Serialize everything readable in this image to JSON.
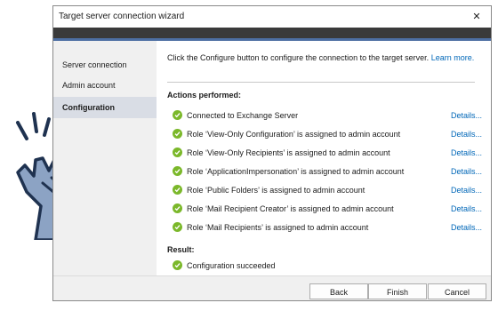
{
  "window": {
    "title": "Target server connection wizard",
    "close_glyph": "✕"
  },
  "sidebar": {
    "items": [
      {
        "label": "Server connection",
        "active": false
      },
      {
        "label": "Admin account",
        "active": false
      },
      {
        "label": "Configuration",
        "active": true
      }
    ]
  },
  "content": {
    "intro_text": "Click the Configure button to configure the connection to the target server.",
    "learn_more": "Learn more.",
    "actions_heading": "Actions performed:",
    "actions": [
      {
        "text": "Connected to Exchange Server",
        "details": "Details..."
      },
      {
        "text": "Role ‘View-Only Configuration’ is assigned to admin account",
        "details": "Details..."
      },
      {
        "text": "Role ‘View-Only Recipients’ is assigned to admin account",
        "details": "Details..."
      },
      {
        "text": "Role ‘ApplicationImpersonation’ is assigned to admin account",
        "details": "Details..."
      },
      {
        "text": "Role ‘Public Folders’ is assigned to admin account",
        "details": "Details..."
      },
      {
        "text": "Role ‘Mail Recipient Creator’ is assigned to admin account",
        "details": "Details..."
      },
      {
        "text": "Role ‘Mail Recipients’ is assigned to admin account",
        "details": "Details..."
      }
    ],
    "result_heading": "Result:",
    "result_text": "Configuration succeeded"
  },
  "footer": {
    "back": "Back",
    "finish": "Finish",
    "cancel": "Cancel"
  },
  "colors": {
    "accent": "#4d6fa3",
    "link": "#0067b8",
    "success": "#7bb82a",
    "hand_outline": "#1f3250",
    "hand_fill": "#8ca3c4"
  },
  "icons": {
    "status": "check-circle-icon",
    "decoration": "snapping-hand-icon"
  }
}
